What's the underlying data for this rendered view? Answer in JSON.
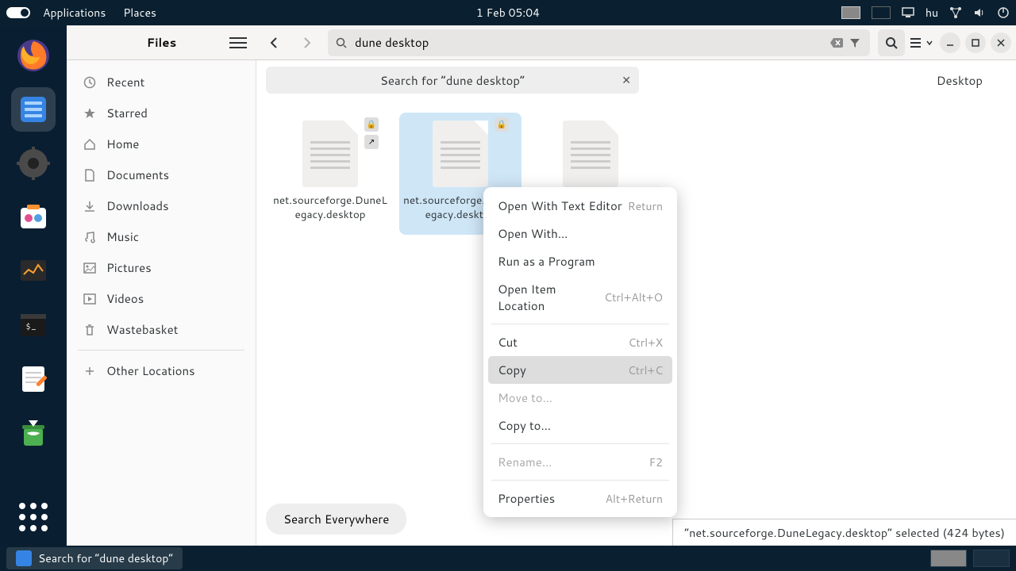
{
  "topbar": {
    "applications": "Applications",
    "places": "Places",
    "clock": "1 Feb  05:04",
    "lang": "hu"
  },
  "dock": {
    "items": [
      "firefox",
      "files",
      "settings",
      "software",
      "monitor",
      "terminal",
      "text-edit",
      "trash"
    ]
  },
  "sidebar_title": "Files",
  "sidebar": {
    "items": [
      {
        "label": "Recent",
        "icon": "clock"
      },
      {
        "label": "Starred",
        "icon": "star"
      },
      {
        "label": "Home",
        "icon": "home"
      },
      {
        "label": "Documents",
        "icon": "doc"
      },
      {
        "label": "Downloads",
        "icon": "down"
      },
      {
        "label": "Music",
        "icon": "music"
      },
      {
        "label": "Pictures",
        "icon": "pic"
      },
      {
        "label": "Videos",
        "icon": "vid"
      },
      {
        "label": "Wastebasket",
        "icon": "trash"
      }
    ],
    "other": "Other Locations"
  },
  "search_value": "dune desktop",
  "search_chip": "Search for “dune desktop”",
  "location": "Desktop",
  "files": [
    {
      "name": "net.sourceforge.DuneLegacy.desktop",
      "selected": false,
      "lock": true,
      "link": true
    },
    {
      "name": "net.sourceforge.DuneLegacy.desktop",
      "selected": true,
      "lock": true,
      "link": false
    },
    {
      "name": "",
      "selected": false,
      "lock": false,
      "link": false
    }
  ],
  "search_everywhere": "Search Everywhere",
  "status": "“net.sourceforge.DuneLegacy.desktop” selected  (424 bytes)",
  "context": [
    {
      "label": "Open With Text Editor",
      "shortcut": "Return"
    },
    {
      "label": "Open With…"
    },
    {
      "label": "Run as a Program"
    },
    {
      "label": "Open Item Location",
      "shortcut": "Ctrl+Alt+O"
    },
    {
      "sep": true
    },
    {
      "label": "Cut",
      "shortcut": "Ctrl+X"
    },
    {
      "label": "Copy",
      "shortcut": "Ctrl+C",
      "hov": true
    },
    {
      "label": "Move to…",
      "dis": true
    },
    {
      "label": "Copy to…"
    },
    {
      "sep": true
    },
    {
      "label": "Rename…",
      "shortcut": "F2",
      "dis": true
    },
    {
      "sep": true
    },
    {
      "label": "Properties",
      "shortcut": "Alt+Return"
    }
  ],
  "taskbar": {
    "title": "Search for “dune desktop”"
  }
}
